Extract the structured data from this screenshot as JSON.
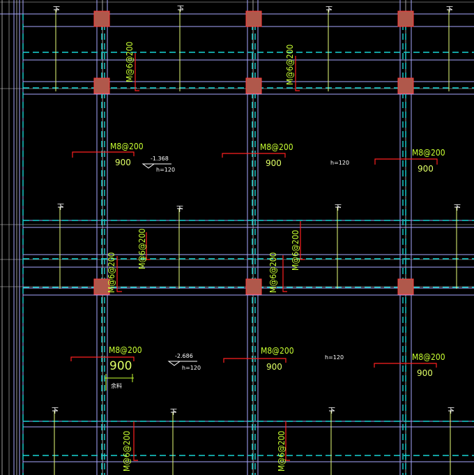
{
  "drawing": {
    "colors": {
      "background": "#000000",
      "wall": "#a7a7ff",
      "grid": "#c9c9c9",
      "dashed": "#19d6d6",
      "column_fill": "#b0584b",
      "column_stroke": "#ff3b3b",
      "rebar_leader": "#ff2020",
      "rebar_text": "#c8ff32",
      "dimension_text": "#e0ff66",
      "section_mark": "#ffffff"
    },
    "rebar_labels_top": [
      "M8@200",
      "M8@200",
      "M8@200",
      "M8@200",
      "M8@200",
      "M8@200"
    ],
    "rebar_labels_vertical": [
      "M@6@200",
      "M@6@200",
      "M@6@200",
      "M@6@200",
      "M@6@200",
      "M@6@200",
      "M@6@200",
      "M@6@200"
    ],
    "span_dims": [
      "900",
      "900",
      "900",
      "900",
      "900",
      "900"
    ],
    "elevations": [
      {
        "level": "-1.368",
        "thickness": "h=120"
      },
      {
        "level": "-2.686",
        "thickness": "h=120"
      }
    ],
    "slab_thickness_notes": [
      "h=120",
      "h=120"
    ],
    "dimension_note": "余料",
    "section_marks": [
      "下",
      "下",
      "下",
      "下",
      "下",
      "下",
      "下",
      "下",
      "下",
      "下",
      "下",
      "下"
    ]
  }
}
